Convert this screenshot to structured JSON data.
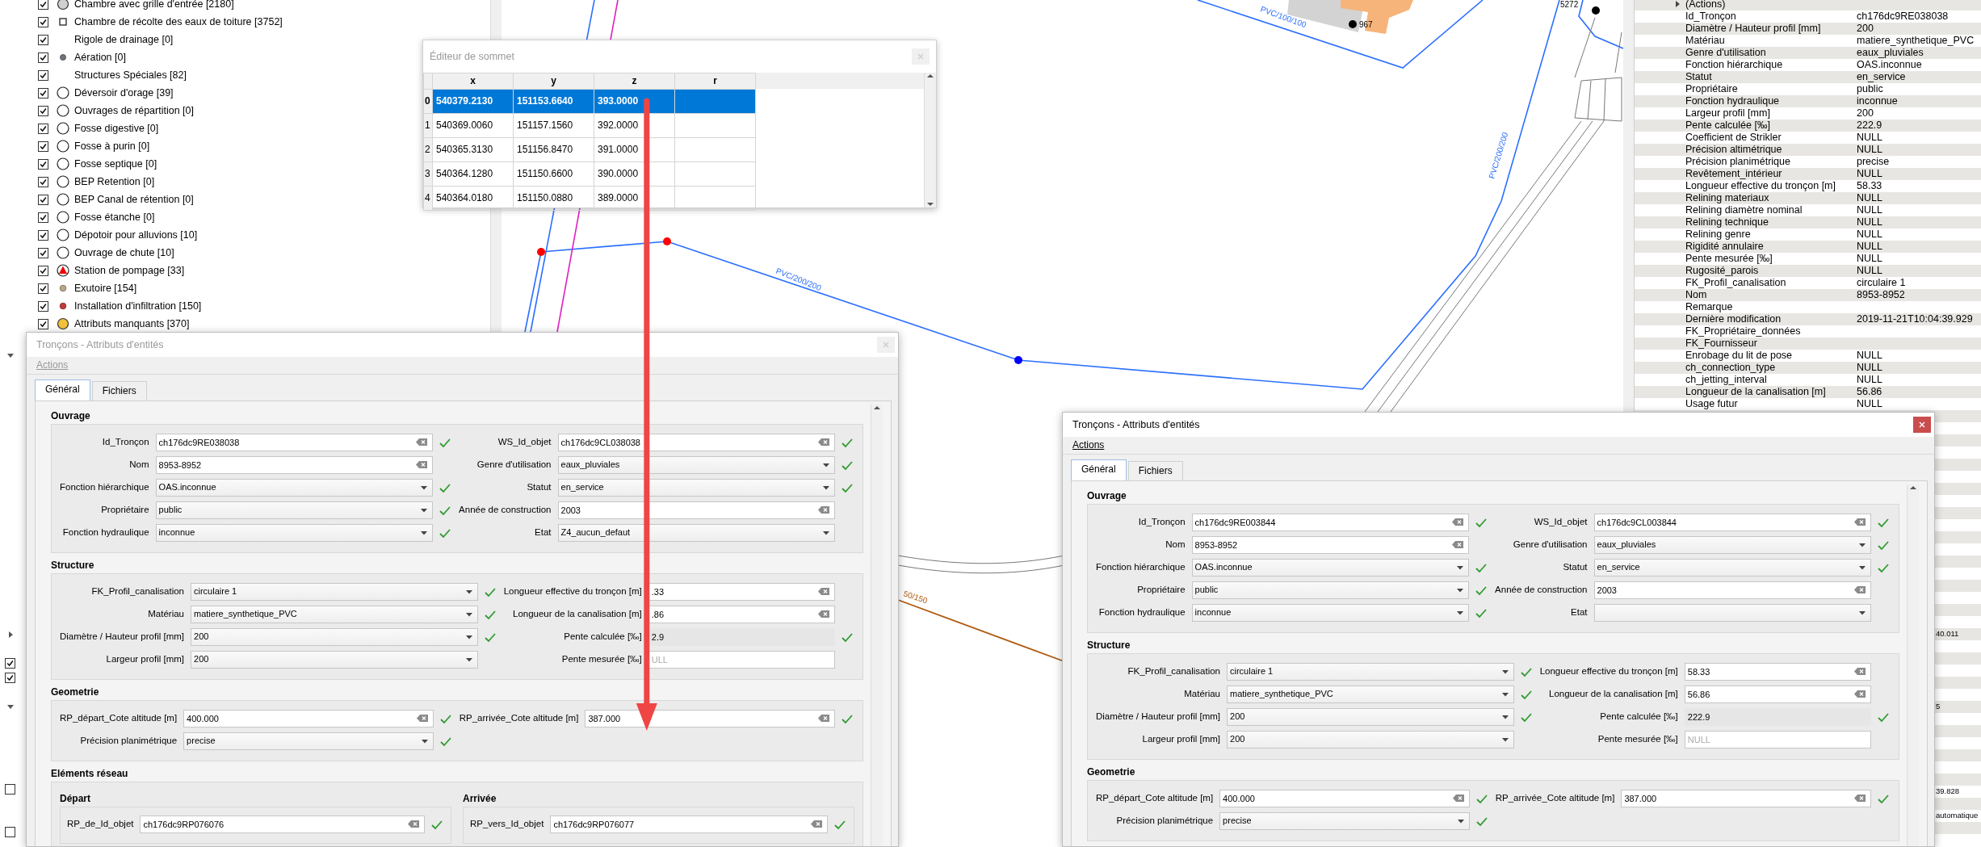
{
  "layers": [
    {
      "label": "Chambre avec grille d'entrée [2180]",
      "checked": true,
      "kind": "grey"
    },
    {
      "label": "Chambre de récolte des eaux de toiture [3752]",
      "checked": true,
      "kind": "square"
    },
    {
      "label": "Rigole de drainage [0]",
      "checked": true,
      "kind": "none"
    },
    {
      "label": "Aération [0]",
      "checked": true,
      "kind": "dot"
    },
    {
      "label": "Structures Spéciales [82]",
      "checked": true,
      "kind": "none"
    },
    {
      "label": "Déversoir d'orage [39]",
      "checked": true,
      "kind": "ring"
    },
    {
      "label": "Ouvrages de répartition [0]",
      "checked": true,
      "kind": "ring"
    },
    {
      "label": "Fosse digestive [0]",
      "checked": true,
      "kind": "ring"
    },
    {
      "label": "Fosse à purin [0]",
      "checked": true,
      "kind": "ring"
    },
    {
      "label": "Fosse septique [0]",
      "checked": true,
      "kind": "ring"
    },
    {
      "label": "BEP Retention [0]",
      "checked": true,
      "kind": "ring"
    },
    {
      "label": "BEP Canal de rétention [0]",
      "checked": true,
      "kind": "ring"
    },
    {
      "label": "Fosse étanche [0]",
      "checked": true,
      "kind": "ring"
    },
    {
      "label": "Dépotoir pour alluvions [10]",
      "checked": true,
      "kind": "ring"
    },
    {
      "label": "Ouvrage de chute [10]",
      "checked": true,
      "kind": "ring"
    },
    {
      "label": "Station de pompage [33]",
      "checked": true,
      "kind": "pump"
    },
    {
      "label": "Exutoire [154]",
      "checked": true,
      "kind": "outlet"
    },
    {
      "label": "Installation d'infiltration [150]",
      "checked": true,
      "kind": "infiltration"
    },
    {
      "label": "Attributs manquants [370]",
      "checked": true,
      "kind": "missing"
    }
  ],
  "side_checkboxes": [
    {
      "checked": true
    },
    {
      "checked": true
    },
    {
      "checked": false
    },
    {
      "checked": false
    }
  ],
  "map": {
    "labels": [
      "PVC/200/200",
      "PVC/200/200",
      "PVC/100/100",
      "5272",
      "967",
      "50/150"
    ]
  },
  "vertex_editor": {
    "title": "Éditeur de sommet",
    "active": false,
    "columns": [
      "x",
      "y",
      "z",
      "r"
    ],
    "rows": [
      {
        "index": "0",
        "cells": [
          "540379.2130",
          "151153.6640",
          "393.0000"
        ],
        "selected": true
      },
      {
        "index": "1",
        "cells": [
          "540369.0060",
          "151157.1560",
          "392.0000"
        ],
        "selected": false
      },
      {
        "index": "2",
        "cells": [
          "540365.3130",
          "151156.8470",
          "391.0000"
        ],
        "selected": false
      },
      {
        "index": "3",
        "cells": [
          "540364.1280",
          "151150.6600",
          "390.0000"
        ],
        "selected": false
      },
      {
        "index": "4",
        "cells": [
          "540364.0180",
          "151150.0880",
          "389.0000"
        ],
        "selected": false
      }
    ]
  },
  "attributes_panel": {
    "actions": "(Actions)",
    "rows": [
      {
        "name": "Id_Tronçon",
        "value": "ch176dc9RE038038"
      },
      {
        "name": "Diamètre / Hauteur profil [mm]",
        "value": "200"
      },
      {
        "name": "Matériau",
        "value": "matiere_synthetique_PVC"
      },
      {
        "name": "Genre d'utilisation",
        "value": "eaux_pluviales"
      },
      {
        "name": "Fonction hiérarchique",
        "value": "OAS.inconnue"
      },
      {
        "name": "Statut",
        "value": "en_service"
      },
      {
        "name": "Propriétaire",
        "value": "public"
      },
      {
        "name": "Fonction hydraulique",
        "value": "inconnue"
      },
      {
        "name": "Largeur profil [mm]",
        "value": "200"
      },
      {
        "name": "Pente calculée [‰]",
        "value": "222.9"
      },
      {
        "name": "Coefficient de Strikler",
        "value": "NULL"
      },
      {
        "name": "Précision altimétrique",
        "value": "NULL"
      },
      {
        "name": "Précision planimétrique",
        "value": "precise"
      },
      {
        "name": "Revêtement_intérieur",
        "value": "NULL"
      },
      {
        "name": "Longueur effective du tronçon [m]",
        "value": "58.33"
      },
      {
        "name": "Relining materiaux",
        "value": "NULL"
      },
      {
        "name": "Relining diamètre nominal",
        "value": "NULL"
      },
      {
        "name": "Relining technique",
        "value": "NULL"
      },
      {
        "name": "Relining genre",
        "value": "NULL"
      },
      {
        "name": "Rigidité annulaire",
        "value": "NULL"
      },
      {
        "name": "Pente mesurée [‰]",
        "value": "NULL"
      },
      {
        "name": "Rugosité_parois",
        "value": "NULL"
      },
      {
        "name": "FK_Profil_canalisation",
        "value": "circulaire 1"
      },
      {
        "name": "Nom",
        "value": "8953-8952"
      },
      {
        "name": "Remarque"
      },
      {
        "name": "Dernière modification",
        "value": "2019-11-21T10:04:39.929"
      },
      {
        "name": "FK_Propriétaire_données"
      },
      {
        "name": "FK_Fournisseur"
      },
      {
        "name": "Enrobage du lit de pose",
        "value": "NULL"
      },
      {
        "name": "ch_connection_type",
        "value": "NULL"
      },
      {
        "name": "ch_jetting_interval",
        "value": "NULL"
      },
      {
        "name": "Longueur de la canalisation [m]",
        "value": "56.86"
      },
      {
        "name": "Usage futur",
        "value": "NULL"
      }
    ],
    "fragments": [
      "40.011",
      "5",
      "39.828",
      "automatique"
    ]
  },
  "dialogs": [
    {
      "title": "Tronçons - Attributs d'entités",
      "active": false,
      "menu": "Actions",
      "tabs": [
        {
          "label": "Général",
          "selected": true
        },
        {
          "label": "Fichiers",
          "selected": false
        }
      ],
      "sections": [
        {
          "title": "Ouvrage",
          "fields": [
            {
              "label": "Id_Tronçon",
              "value": "ch176dc9RE038038",
              "kind": "text",
              "valid": true
            },
            {
              "label": "WS_Id_objet",
              "value": "ch176dc9CL038038",
              "kind": "text",
              "valid": true
            },
            {
              "label": "Nom",
              "value": "8953-8952",
              "kind": "text",
              "valid": false
            },
            {
              "label": "Genre d'utilisation",
              "value": "eaux_pluviales",
              "kind": "select",
              "valid": true
            },
            {
              "label": "Fonction hiérarchique",
              "value": "OAS.inconnue",
              "kind": "select",
              "valid": true
            },
            {
              "label": "Statut",
              "value": "en_service",
              "kind": "select",
              "valid": true
            },
            {
              "label": "Propriétaire",
              "value": "public",
              "kind": "select",
              "valid": true
            },
            {
              "label": "Année de construction",
              "value": "2003",
              "kind": "text",
              "valid": false
            },
            {
              "label": "Fonction hydraulique",
              "value": "inconnue",
              "kind": "select",
              "valid": true
            },
            {
              "label": "Etat",
              "value": "Z4_aucun_defaut",
              "kind": "select",
              "valid": false
            }
          ]
        },
        {
          "title": "Structure",
          "fields": [
            {
              "label": "FK_Profil_canalisation",
              "value": "circulaire 1",
              "kind": "select",
              "valid": true
            },
            {
              "label": "Longueur effective du tronçon [m]",
              "value": ".33",
              "kind": "text",
              "valid": false
            },
            {
              "label": "Matériau",
              "value": "matiere_synthetique_PVC",
              "kind": "select",
              "valid": true
            },
            {
              "label": "Longueur de la canalisation [m]",
              "value": ".86",
              "kind": "text",
              "valid": false
            },
            {
              "label": "Diamètre / Hauteur profil [mm]",
              "value": "200",
              "kind": "select",
              "valid": true
            },
            {
              "label": "Pente calculée [‰]",
              "value": "2.9",
              "kind": "readonly",
              "valid": true
            },
            {
              "label": "Largeur profil [mm]",
              "value": "200",
              "kind": "select",
              "valid": false
            },
            {
              "label": "Pente mesurée [‰]",
              "placeholder": "ULL",
              "kind": "plain",
              "valid": false
            }
          ]
        },
        {
          "title": "Geometrie",
          "fields": [
            {
              "label": "RP_départ_Cote altitude [m]",
              "value": "400.000",
              "kind": "text",
              "valid": true
            },
            {
              "label": "RP_arrivée_Cote altitude [m]",
              "value": "387.000",
              "kind": "text",
              "valid": true
            },
            {
              "label": "Précision planimétrique",
              "value": "precise",
              "kind": "select",
              "valid": true
            }
          ]
        },
        {
          "title": "Eléments réseau",
          "groups": [
            {
              "title": "Départ",
              "fields": [
                {
                  "label": "RP_de_Id_objet",
                  "value": "ch176dc9RP076076",
                  "kind": "text",
                  "valid": true
                }
              ]
            },
            {
              "title": "Arrivée",
              "fields": [
                {
                  "label": "RP_vers_Id_objet",
                  "value": "ch176dc9RP076077",
                  "kind": "text",
                  "valid": true
                }
              ]
            }
          ]
        }
      ]
    },
    {
      "title": "Tronçons - Attributs d'entités",
      "active": true,
      "menu": "Actions",
      "tabs": [
        {
          "label": "Général",
          "selected": true
        },
        {
          "label": "Fichiers",
          "selected": false
        }
      ],
      "sections": [
        {
          "title": "Ouvrage",
          "fields": [
            {
              "label": "Id_Tronçon",
              "value": "ch176dc9RE003844",
              "kind": "text",
              "valid": true
            },
            {
              "label": "WS_Id_objet",
              "value": "ch176dc9CL003844",
              "kind": "text",
              "valid": true
            },
            {
              "label": "Nom",
              "value": "8953-8952",
              "kind": "text",
              "valid": false
            },
            {
              "label": "Genre d'utilisation",
              "value": "eaux_pluviales",
              "kind": "select",
              "valid": true
            },
            {
              "label": "Fonction hiérarchique",
              "value": "OAS.inconnue",
              "kind": "select",
              "valid": true
            },
            {
              "label": "Statut",
              "value": "en_service",
              "kind": "select",
              "valid": true
            },
            {
              "label": "Propriétaire",
              "value": "public",
              "kind": "select",
              "valid": true
            },
            {
              "label": "Année de construction",
              "value": "2003",
              "kind": "text",
              "valid": false
            },
            {
              "label": "Fonction hydraulique",
              "value": "inconnue",
              "kind": "select",
              "valid": true
            },
            {
              "label": "Etat",
              "kind": "select",
              "valid": false
            }
          ]
        },
        {
          "title": "Structure",
          "fields": [
            {
              "label": "FK_Profil_canalisation",
              "value": "circulaire 1",
              "kind": "select",
              "valid": true
            },
            {
              "label": "Longueur effective du tronçon [m]",
              "value": "58.33",
              "kind": "text",
              "valid": false
            },
            {
              "label": "Matériau",
              "value": "matiere_synthetique_PVC",
              "kind": "select",
              "valid": true
            },
            {
              "label": "Longueur de la canalisation [m]",
              "value": "56.86",
              "kind": "text",
              "valid": false
            },
            {
              "label": "Diamètre / Hauteur profil [mm]",
              "value": "200",
              "kind": "select",
              "valid": true
            },
            {
              "label": "Pente calculée [‰]",
              "value": "222.9",
              "kind": "readonly",
              "valid": true
            },
            {
              "label": "Largeur profil [mm]",
              "value": "200",
              "kind": "select",
              "valid": false
            },
            {
              "label": "Pente mesurée [‰]",
              "placeholder": "NULL",
              "kind": "plain",
              "valid": false
            }
          ]
        },
        {
          "title": "Geometrie",
          "fields": [
            {
              "label": "RP_départ_Cote altitude [m]",
              "value": "400.000",
              "kind": "text",
              "valid": true
            },
            {
              "label": "RP_arrivée_Cote altitude [m]",
              "value": "387.000",
              "kind": "text",
              "valid": true
            },
            {
              "label": "Précision planimétrique",
              "value": "precise",
              "kind": "select",
              "valid": true
            }
          ]
        }
      ]
    }
  ]
}
